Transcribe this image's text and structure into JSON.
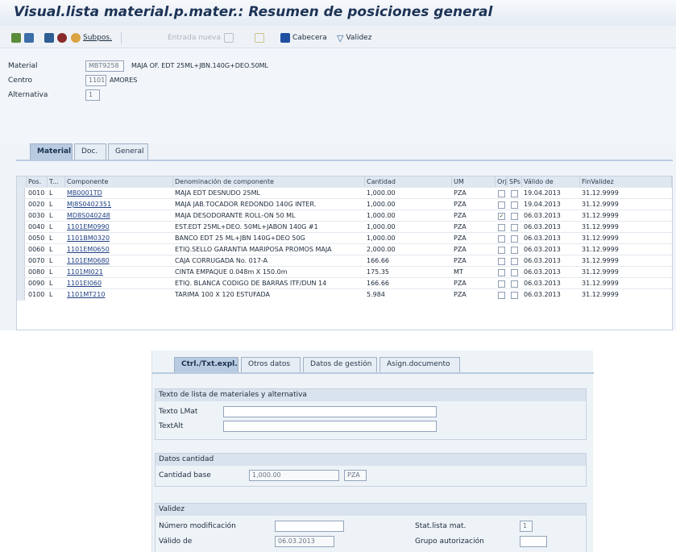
{
  "title": "Visual.lista material.p.mater.: Resumen de posiciones general",
  "toolbar": {
    "subpos": "Subpos.",
    "entrada_nueva": "Entrada nueva",
    "cabecera": "Cabecera",
    "validez": "Validez"
  },
  "header": {
    "material_label": "Material",
    "material_value": "MBT9258",
    "material_desc": "MAJA OF. EDT 25ML+JBN.140G+DEO.50ML",
    "centro_label": "Centro",
    "centro_value": "1101",
    "centro_desc": "AMORES",
    "alternativa_label": "Alternativa",
    "alternativa_value": "1"
  },
  "tabs_main": [
    "Material",
    "Doc.",
    "General"
  ],
  "table": {
    "headers": [
      "Pos.",
      "T...",
      "Componente",
      "Denominación de componente",
      "Cantidad",
      "UM",
      "Orj",
      "SPs",
      "Válido de",
      "FinValidez"
    ],
    "rows": [
      {
        "pos": "0010",
        "t": "L",
        "comp": "MB0001TD",
        "desc": "MAJA EDT DESNUDO 25ML",
        "cant": "1,000.00",
        "um": "PZA",
        "orj": false,
        "sps": false,
        "desde": "19.04.2013",
        "hasta": "31.12.9999"
      },
      {
        "pos": "0020",
        "t": "L",
        "comp": "MJ8S0402351",
        "desc": "MAJA JAB.TOCADOR REDONDO 140G INTER.",
        "cant": "1,000.00",
        "um": "PZA",
        "orj": false,
        "sps": false,
        "desde": "19.04.2013",
        "hasta": "31.12.9999"
      },
      {
        "pos": "0030",
        "t": "L",
        "comp": "MD8S040248",
        "desc": "MAJA DESODORANTE ROLL-ON 50 ML",
        "cant": "1,000.00",
        "um": "PZA",
        "orj": true,
        "sps": false,
        "desde": "06.03.2013",
        "hasta": "31.12.9999"
      },
      {
        "pos": "0040",
        "t": "L",
        "comp": "1101EM0990",
        "desc": "EST.EDT 25ML+DEO. 50ML+JABON 140G #1",
        "cant": "1,000.00",
        "um": "PZA",
        "orj": false,
        "sps": false,
        "desde": "06.03.2013",
        "hasta": "31.12.9999"
      },
      {
        "pos": "0050",
        "t": "L",
        "comp": "1101BM0320",
        "desc": "BANCO EDT 25 ML+JBN 140G+DEO 50G",
        "cant": "1,000.00",
        "um": "PZA",
        "orj": false,
        "sps": false,
        "desde": "06.03.2013",
        "hasta": "31.12.9999"
      },
      {
        "pos": "0060",
        "t": "L",
        "comp": "1101EM0650",
        "desc": "ETIQ.SELLO GARANTIA MARIPOSA PROMOS MAJA",
        "cant": "2,000.00",
        "um": "PZA",
        "orj": false,
        "sps": false,
        "desde": "06.03.2013",
        "hasta": "31.12.9999"
      },
      {
        "pos": "0070",
        "t": "L",
        "comp": "1101EM0680",
        "desc": "CAJA CORRUGADA No. 017-A",
        "cant": "166.66",
        "um": "PZA",
        "orj": false,
        "sps": false,
        "desde": "06.03.2013",
        "hasta": "31.12.9999"
      },
      {
        "pos": "0080",
        "t": "L",
        "comp": "1101MI021",
        "desc": "CINTA EMPAQUE 0.048m X 150.0m",
        "cant": "175.35",
        "um": "MT",
        "orj": false,
        "sps": false,
        "desde": "06.03.2013",
        "hasta": "31.12.9999"
      },
      {
        "pos": "0090",
        "t": "L",
        "comp": "1101EI060",
        "desc": "ETIQ. BLANCA CODIGO DE BARRAS ITF/DUN 14",
        "cant": "166.66",
        "um": "PZA",
        "orj": false,
        "sps": false,
        "desde": "06.03.2013",
        "hasta": "31.12.9999"
      },
      {
        "pos": "0100",
        "t": "L",
        "comp": "1101MT210",
        "desc": "TARIMA 100 X 120 ESTUFADA",
        "cant": "5.984",
        "um": "PZA",
        "orj": false,
        "sps": false,
        "desde": "06.03.2013",
        "hasta": "31.12.9999"
      }
    ]
  },
  "popup": {
    "tabs": [
      "Ctrl./Txt.expl.",
      "Otros datos",
      "Datos de gestión",
      "Asign.documento"
    ],
    "g1_title": "Texto de lista de materiales y alternativa",
    "texto_lmat_label": "Texto LMat",
    "texto_lmat_value": "",
    "textalt_label": "TextAlt",
    "textalt_value": "",
    "g2_title": "Datos cantidad",
    "cant_base_label": "Cantidad base",
    "cant_base_value": "1,000.00",
    "cant_base_um": "PZA",
    "g3_title": "Validez",
    "num_mod_label": "Número modificación",
    "num_mod_value": "",
    "valido_de_label": "Válido de",
    "valido_de_value": "06.03.2013",
    "stat_label": "Stat.lista mat.",
    "stat_value": "1",
    "grupo_label": "Grupo autorización",
    "grupo_value": ""
  },
  "colors": {
    "title_text": "#1c3356",
    "tab_active": "#b9cbe0",
    "link": "#1d3f82"
  }
}
